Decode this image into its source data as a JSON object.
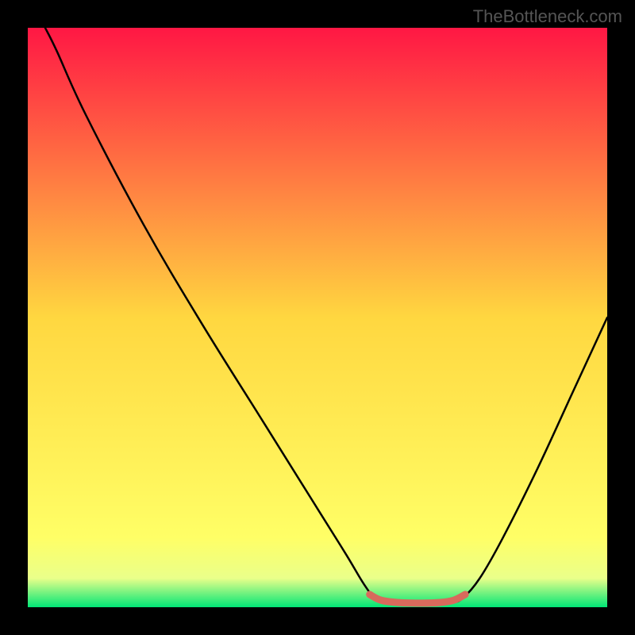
{
  "watermark": "TheBottleneck.com",
  "chart_data": {
    "type": "line",
    "title": "",
    "xlabel": "",
    "ylabel": "",
    "xlim": [
      0,
      100
    ],
    "ylim": [
      0,
      100
    ],
    "background_gradient": {
      "stops": [
        {
          "offset": 0.0,
          "color": "#ff1744"
        },
        {
          "offset": 0.5,
          "color": "#ffd740"
        },
        {
          "offset": 0.88,
          "color": "#ffff66"
        },
        {
          "offset": 0.95,
          "color": "#eaff8a"
        },
        {
          "offset": 1.0,
          "color": "#00e676"
        }
      ]
    },
    "series": [
      {
        "name": "curve",
        "type": "path",
        "color": "#000000",
        "width": 2.5,
        "points": [
          {
            "x": 3,
            "y": 100
          },
          {
            "x": 5,
            "y": 96
          },
          {
            "x": 10,
            "y": 85
          },
          {
            "x": 20,
            "y": 66
          },
          {
            "x": 30,
            "y": 49
          },
          {
            "x": 40,
            "y": 33
          },
          {
            "x": 50,
            "y": 17
          },
          {
            "x": 55,
            "y": 9
          },
          {
            "x": 58,
            "y": 4
          },
          {
            "x": 60,
            "y": 1.5
          },
          {
            "x": 62,
            "y": 0.8
          },
          {
            "x": 66,
            "y": 0.6
          },
          {
            "x": 70,
            "y": 0.6
          },
          {
            "x": 73,
            "y": 0.8
          },
          {
            "x": 75,
            "y": 1.5
          },
          {
            "x": 78,
            "y": 5
          },
          {
            "x": 82,
            "y": 12
          },
          {
            "x": 88,
            "y": 24
          },
          {
            "x": 94,
            "y": 37
          },
          {
            "x": 100,
            "y": 50
          }
        ]
      },
      {
        "name": "highlight-segment",
        "type": "path",
        "color": "#d86a5c",
        "width": 9,
        "points": [
          {
            "x": 59,
            "y": 2.2
          },
          {
            "x": 61,
            "y": 1.2
          },
          {
            "x": 64,
            "y": 0.8
          },
          {
            "x": 68,
            "y": 0.7
          },
          {
            "x": 71,
            "y": 0.8
          },
          {
            "x": 73.5,
            "y": 1.2
          },
          {
            "x": 75.5,
            "y": 2.2
          }
        ]
      }
    ]
  }
}
